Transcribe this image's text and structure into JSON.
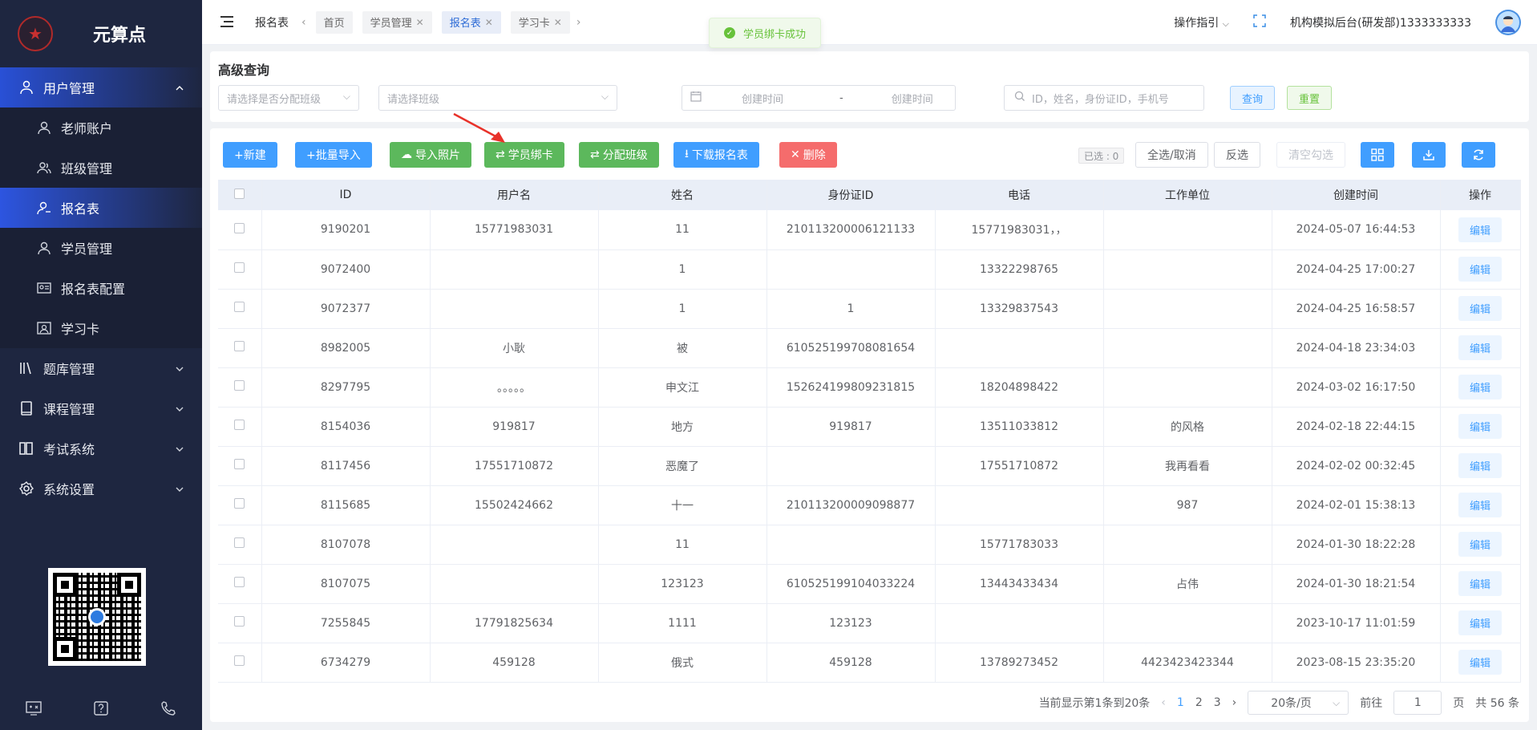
{
  "app": {
    "name": "元算点",
    "logo_glyph": "★"
  },
  "sidebar": {
    "groups": [
      {
        "label": "用户管理",
        "icon": "users-icon",
        "expanded": true,
        "active": true
      },
      {
        "label": "题库管理",
        "icon": "library-icon"
      },
      {
        "label": "课程管理",
        "icon": "book-icon"
      },
      {
        "label": "考试系统",
        "icon": "exam-icon"
      },
      {
        "label": "系统设置",
        "icon": "gear-icon"
      }
    ],
    "sub_items": [
      {
        "label": "老师账户",
        "icon": "user-icon"
      },
      {
        "label": "班级管理",
        "icon": "group-icon"
      },
      {
        "label": "报名表",
        "icon": "user-form-icon",
        "active": true
      },
      {
        "label": "学员管理",
        "icon": "user-icon"
      },
      {
        "label": "报名表配置",
        "icon": "id-card-icon"
      },
      {
        "label": "学习卡",
        "icon": "card-icon"
      }
    ]
  },
  "topbar": {
    "page_title": "报名表",
    "tabs": [
      {
        "label": "首页",
        "closable": false
      },
      {
        "label": "学员管理",
        "closable": true
      },
      {
        "label": "报名表",
        "closable": true,
        "active": true
      },
      {
        "label": "学习卡",
        "closable": true
      }
    ],
    "guide_label": "操作指引",
    "org_label": "机构模拟后台(研发部)1333333333"
  },
  "toast": {
    "message": "学员绑卡成功"
  },
  "search": {
    "title": "高级查询",
    "assigned_placeholder": "请选择是否分配班级",
    "class_placeholder": "请选择班级",
    "date_start_placeholder": "创建时间",
    "date_separator": "-",
    "date_end_placeholder": "创建时间",
    "keyword_placeholder": "ID，姓名，身份证ID，手机号",
    "query_label": "查询",
    "reset_label": "重置"
  },
  "toolbar": {
    "new_label": "+新建",
    "batch_import_label": "+批量导入",
    "import_photo_label": "导入照片",
    "bind_card_label": "学员绑卡",
    "assign_class_label": "分配班级",
    "download_label": "下载报名表",
    "delete_label": "删除",
    "selected_label": "已选 : 0",
    "toggle_all_label": "全选/取消",
    "invert_label": "反选",
    "clear_label": "清空勾选"
  },
  "table": {
    "headers": [
      "ID",
      "用户名",
      "姓名",
      "身份证ID",
      "电话",
      "工作单位",
      "创建时间",
      "操作"
    ],
    "edit_label": "编辑",
    "rows": [
      [
        "9190201",
        "15771983031",
        "11",
        "210113200006121133",
        "15771983031，，",
        "",
        "2024-05-07 16:44:53"
      ],
      [
        "9072400",
        "",
        "1",
        "",
        "13322298765",
        "",
        "2024-04-25 17:00:27"
      ],
      [
        "9072377",
        "",
        "1",
        "1",
        "13329837543",
        "",
        "2024-04-25 16:58:57"
      ],
      [
        "8982005",
        "小耿",
        "被",
        "610525199708081654",
        "",
        "",
        "2024-04-18 23:34:03"
      ],
      [
        "8297795",
        "。。。。。",
        "申文江",
        "152624199809231815",
        "18204898422",
        "",
        "2024-03-02 16:17:50"
      ],
      [
        "8154036",
        "919817",
        "地方",
        "919817",
        "13511033812",
        "的风格",
        "2024-02-18 22:44:15"
      ],
      [
        "8117456",
        "17551710872",
        "恶魔了",
        "",
        "17551710872",
        "我再看看",
        "2024-02-02 00:32:45"
      ],
      [
        "8115685",
        "15502424662",
        "十一",
        "210113200009098877",
        "",
        "987",
        "2024-02-01 15:38:13"
      ],
      [
        "8107078",
        "",
        "11",
        "",
        "15771783033",
        "",
        "2024-01-30 18:22:28"
      ],
      [
        "8107075",
        "",
        "123123",
        "610525199104033224",
        "13443433434",
        "占伟",
        "2024-01-30 18:21:54"
      ],
      [
        "7255845",
        "17791825634",
        "1111",
        "123123",
        "",
        "",
        "2023-10-17 11:01:59"
      ],
      [
        "6734279",
        "459128",
        "俄式",
        "459128",
        "13789273452",
        "4423423423344",
        "2023-08-15 23:35:20"
      ]
    ]
  },
  "pagination": {
    "summary": "当前显示第1条到20条",
    "pages": [
      "1",
      "2",
      "3"
    ],
    "current_page": "1",
    "page_size": "20条/页",
    "goto_label": "前往",
    "goto_value": "1",
    "page_unit": "页",
    "total_label": "共 56 条"
  },
  "colors": {
    "primary": "#409eff",
    "success": "#5cb85c",
    "danger": "#f56c6c",
    "sidebar_bg": "#1e2640"
  }
}
